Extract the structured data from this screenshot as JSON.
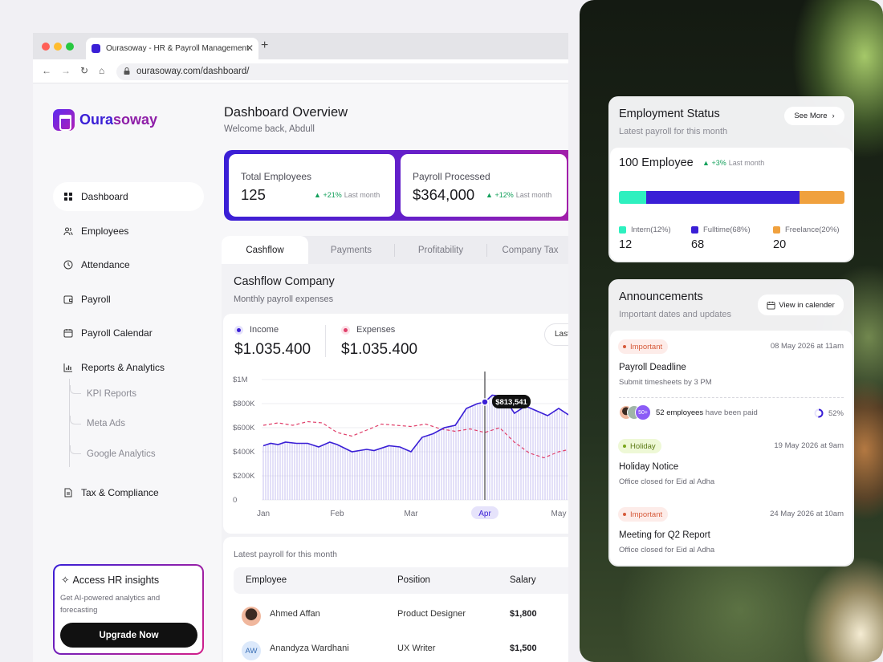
{
  "browser": {
    "tab_title": "Ourasoway - HR & Payroll Management",
    "url": "ourasoway.com/dashboard/"
  },
  "brand": {
    "part1": "Oura",
    "part2": "soway"
  },
  "sidebar": {
    "items": [
      {
        "label": "Dashboard",
        "icon": "grid-icon",
        "active": true
      },
      {
        "label": "Employees",
        "icon": "users-icon"
      },
      {
        "label": "Attendance",
        "icon": "clock-icon"
      },
      {
        "label": "Payroll",
        "icon": "wallet-icon"
      },
      {
        "label": "Payroll Calendar",
        "icon": "calendar-icon"
      },
      {
        "label": "Reports & Analytics",
        "icon": "bar-chart-icon"
      }
    ],
    "sub_items": [
      "KPI Reports",
      "Meta Ads",
      "Google Analytics"
    ],
    "tax": {
      "label": "Tax & Compliance",
      "icon": "document-icon"
    },
    "promo": {
      "title": "Access HR insights",
      "description": "Get AI-powered analytics and forecasting",
      "button": "Upgrade Now"
    }
  },
  "page": {
    "title": "Dashboard Overview",
    "subtitle": "Welcome back, Abdull"
  },
  "stats": [
    {
      "label": "Total Employees",
      "value": "125",
      "change": "+21%",
      "period": "Last month"
    },
    {
      "label": "Payroll Processed",
      "value": "$364,000",
      "change": "+12%",
      "period": "Last month"
    }
  ],
  "tabs": [
    "Cashflow",
    "Payments",
    "Profitability",
    "Company Tax"
  ],
  "cashflow": {
    "title": "Cashflow Company",
    "subtitle": "Monthly payroll expenses",
    "income_label": "Income",
    "income_value": "$1.035.400",
    "expenses_label": "Expenses",
    "expenses_value": "$1.035.400",
    "range_button": "Last",
    "tooltip": "$813,541",
    "colors": {
      "income": "#3a1fd6",
      "expenses": "#e0406b"
    }
  },
  "chart_data": {
    "type": "line",
    "x": [
      "Jan",
      "Feb",
      "Mar",
      "Apr",
      "May"
    ],
    "highlighted_x": "Apr",
    "y_ticks": [
      "0",
      "$200K",
      "$400K",
      "$600K",
      "$800K",
      "$1M"
    ],
    "ylim": [
      0,
      1000000
    ],
    "series": [
      {
        "name": "Income",
        "x": [
          0.0,
          0.1,
          0.2,
          0.3,
          0.45,
          0.6,
          0.75,
          0.9,
          1.0,
          1.2,
          1.4,
          1.5,
          1.7,
          1.85,
          2.0,
          2.15,
          2.3,
          2.45,
          2.6,
          2.75,
          2.9,
          3.0,
          3.1,
          3.25,
          3.4,
          3.55,
          3.7,
          3.85,
          4.0,
          4.15
        ],
        "values": [
          450000,
          470000,
          460000,
          480000,
          470000,
          470000,
          440000,
          480000,
          460000,
          400000,
          420000,
          410000,
          450000,
          440000,
          400000,
          520000,
          550000,
          600000,
          620000,
          760000,
          800000,
          813541,
          870000,
          860000,
          720000,
          780000,
          740000,
          700000,
          760000,
          700000
        ]
      },
      {
        "name": "Expenses",
        "x": [
          0.0,
          0.2,
          0.4,
          0.6,
          0.8,
          1.0,
          1.2,
          1.4,
          1.6,
          1.8,
          2.0,
          2.2,
          2.4,
          2.6,
          2.8,
          3.0,
          3.2,
          3.4,
          3.6,
          3.8,
          4.0,
          4.15
        ],
        "values": [
          620000,
          640000,
          620000,
          650000,
          640000,
          560000,
          530000,
          580000,
          630000,
          620000,
          610000,
          630000,
          590000,
          570000,
          590000,
          560000,
          600000,
          480000,
          390000,
          350000,
          400000,
          420000
        ]
      }
    ]
  },
  "payroll_table": {
    "caption": "Latest payroll for this month",
    "columns": [
      "Employee",
      "Position",
      "Salary"
    ],
    "rows": [
      {
        "name": "Ahmed Affan",
        "position": "Product Designer",
        "salary": "$1,800",
        "avatar": "photo"
      },
      {
        "name": "Anandyza Wardhani",
        "position": "UX Writer",
        "salary": "$1,500",
        "initials": "AW"
      }
    ]
  },
  "employment": {
    "title": "Employment Status",
    "subtitle": "Latest payroll for this month",
    "see_more": "See More",
    "total_label": "100 Employee",
    "change": "+3%",
    "period": "Last month",
    "segments": [
      {
        "label": "Intern",
        "pct_label": "(12%)",
        "value": "12",
        "share": 0.12,
        "color": "#2ef0bf"
      },
      {
        "label": "Fulltime",
        "pct_label": "(68%)",
        "value": "68",
        "share": 0.68,
        "color": "#3a1fd6"
      },
      {
        "label": "Freelance",
        "pct_label": "(20%)",
        "value": "20",
        "share": 0.2,
        "color": "#f0a13e"
      }
    ]
  },
  "announcements": {
    "title": "Announcements",
    "subtitle": "Important dates and updates",
    "button": "View in calender",
    "items": [
      {
        "badge": "Important",
        "date": "08 May 2026 at 11am",
        "title": "Payroll Deadline",
        "desc": "Submit timesheets by 3 PM"
      },
      {
        "badge": "Holiday",
        "date": "19 May 2026 at 9am",
        "title": "Holiday Notice",
        "desc": "Office closed for Eid al Adha"
      },
      {
        "badge": "Important",
        "date": "24 May 2026 at 10am",
        "title": "Meeting for Q2 Report",
        "desc": "Office closed for Eid al Adha"
      }
    ],
    "paid": {
      "count_badge": "50+",
      "count": "52 employees",
      "text": "have been paid",
      "percent": "52%",
      "share": 0.52
    }
  }
}
